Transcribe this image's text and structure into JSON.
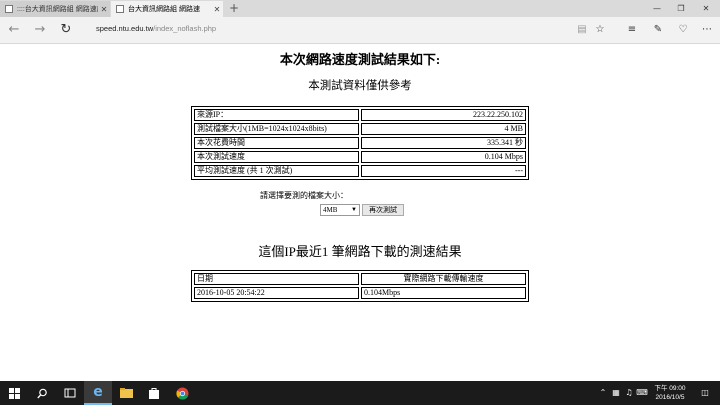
{
  "browser": {
    "tabs": [
      {
        "title": "::::台大資訊網路組 網路速度",
        "active": false
      },
      {
        "title": "台大資訊網路組 網路速",
        "active": true
      }
    ],
    "new_tab_glyph": "+",
    "window_controls": {
      "minimize": "—",
      "restore": "❐",
      "close": "✕"
    },
    "address": {
      "domain": "speed.ntu.edu.tw",
      "path": "/index_noflash.php"
    },
    "icons": [
      "back-icon",
      "forward-icon",
      "refresh-icon",
      "reading-view-icon",
      "favorite-star-icon",
      "hub-icon",
      "web-note-icon",
      "share-icon",
      "more-icon"
    ]
  },
  "page": {
    "heading": "本次網路速度測試結果如下:",
    "subheading": "本測試資料僅供參考",
    "results": [
      {
        "label": "來源IP：",
        "value": "223.22.250.102"
      },
      {
        "label": "測試檔案大小(1MB=1024x1024x8bits)",
        "value": "4 MB"
      },
      {
        "label": "本次花費時間",
        "value": "335.341 秒"
      },
      {
        "label": "本次測試速度",
        "value": "0.104 Mbps"
      },
      {
        "label": "平均測試速度 (共 1 次測試)",
        "value": "---"
      }
    ],
    "select_prompt": "請選擇要測的檔案大小：",
    "file_size_selected": "4MB",
    "retest_button": "再次測試",
    "history_heading": "這個IP最近1 筆網路下載的測速結果",
    "history_headers": [
      "日期",
      "實際網路下載傳輸速度"
    ],
    "history_rows": [
      {
        "date": "2016-10-05 20:54:22",
        "speed": "0.104Mbps"
      }
    ]
  },
  "taskbar": {
    "time": "下午 09:00",
    "date": "2016/10/5",
    "accent": "#76b9ed"
  }
}
